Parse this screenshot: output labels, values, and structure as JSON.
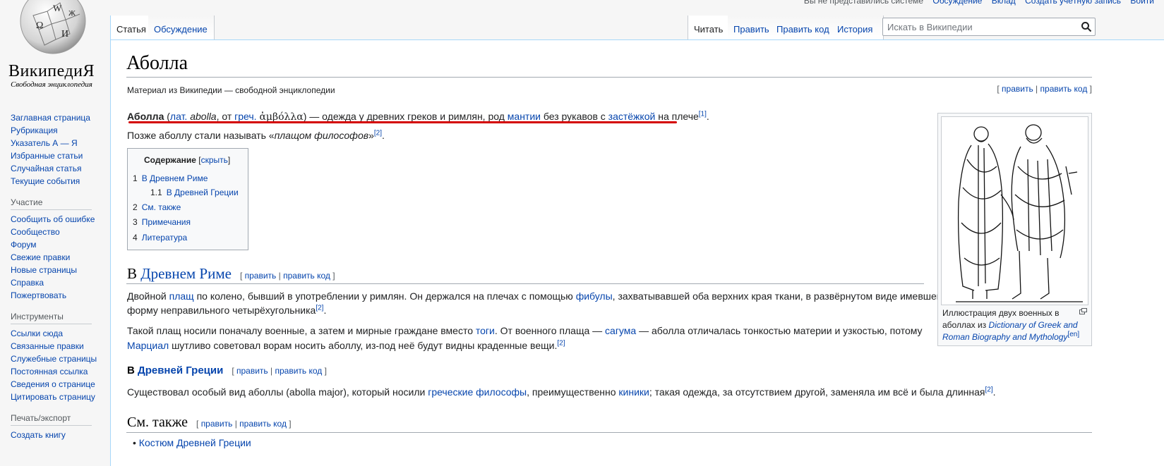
{
  "personal": [
    "Вы не представились системе",
    "Обсуждение",
    "Вклад",
    "Создать учётную запись",
    "Войти"
  ],
  "logo": {
    "wordmark": "ВикипедиЯ",
    "tagline": "Свободная энциклопедия",
    "globe_letters": [
      "Ω",
      "W",
      "И",
      "Ж"
    ]
  },
  "sidebar": {
    "nav": [
      "Заглавная страница",
      "Рубрикация",
      "Указатель А — Я",
      "Избранные статьи",
      "Случайная статья",
      "Текущие события"
    ],
    "participation_head": "Участие",
    "participation": [
      "Сообщить об ошибке",
      "Сообщество",
      "Форум",
      "Свежие правки",
      "Новые страницы",
      "Справка",
      "Пожертвовать"
    ],
    "tools_head": "Инструменты",
    "tools": [
      "Ссылки сюда",
      "Связанные правки",
      "Служебные страницы",
      "Постоянная ссылка",
      "Сведения о странице",
      "Цитировать страницу"
    ],
    "print_head": "Печать/экспорт",
    "print": [
      "Создать книгу"
    ]
  },
  "tabs": {
    "article": "Статья",
    "talk": "Обсуждение",
    "read": "Читать",
    "edit": "Править",
    "edit_source": "Править код",
    "history": "История"
  },
  "search": {
    "placeholder": "Искать в Википедии",
    "icon": "search-icon"
  },
  "article": {
    "title": "Аболла",
    "from": "Материал из Википедии — свободной энциклопедии",
    "edit": "править",
    "edit_source": "править код",
    "lead": {
      "bold": "Аболла",
      "lat": "лат.",
      "latword": "abolla",
      "from": ", от",
      "greek": "греч.",
      "greekword": "ἀμβόλλα",
      "text1": ") — одежда у древних греков и римлян, род",
      "link1": "мантии",
      "text2": "без рукавов с",
      "link2": "застёжкой",
      "text3": "на плече",
      "ref": "[1]"
    },
    "lead2": {
      "text": "Позже аболлу стали называть «",
      "italic": "плащом философов",
      "end": "»",
      "ref": "[2]"
    },
    "toc": {
      "title": "Содержание",
      "hide": "скрыть",
      "items": [
        {
          "num": "1",
          "label": "В Древнем Риме"
        },
        {
          "num": "1.1",
          "label": "В Древней Греции"
        },
        {
          "num": "2",
          "label": "См. также"
        },
        {
          "num": "3",
          "label": "Примечания"
        },
        {
          "num": "4",
          "label": "Литература"
        }
      ]
    },
    "s1": {
      "pre": "В",
      "link": "Древнем Риме",
      "p1": {
        "a": "Двойной",
        "l1": "плащ",
        "b": "по колено, бывший в употреблении у римлян. Он держался на плечах с помощью",
        "l2": "фибулы",
        "c": ", захватывавшей оба верхних края ткани, в развёрнутом виде имевшей",
        "d": "форму неправильного четырёхугольника",
        "ref": "[2]"
      },
      "p2": {
        "a": "Такой плащ носили поначалу военные, а затем и мирные граждане вместо",
        "l1": "тоги",
        "b": ". От военного плаща —",
        "l2": "сагума",
        "c": "— аболла отличалась тонкостью материи и узкостью, потому",
        "l3": "Марциал",
        "d": "шутливо советовал ворам носить аболлу, из-под неё будут видны краденные вещи.",
        "ref": "[2]"
      }
    },
    "s11": {
      "pre": "В",
      "link": "Древней Греции",
      "p": {
        "a": "Существовал особый вид аболлы (abolla major), который носили",
        "l1": "греческие философы",
        "b": ", преимущественно",
        "l2": "киники",
        "c": "; такая одежда, за отсутствием другой, заменяла им всё и была длинная",
        "ref": "[2]"
      }
    },
    "s2": {
      "title": "См. также",
      "item": "Костюм Древней Греции"
    },
    "thumb": {
      "caption_a": "Иллюстрация двух военных в",
      "caption_b": "аболлах из",
      "caption_link": "Dictionary of Greek and Roman Biography and Mythology",
      "caption_sup": "[en]"
    }
  }
}
